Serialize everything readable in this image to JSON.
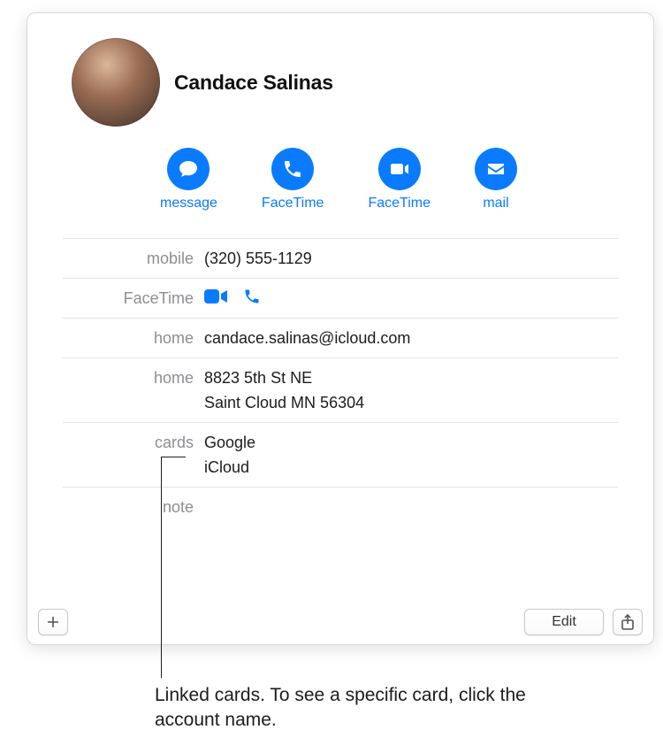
{
  "contact": {
    "name": "Candace Salinas"
  },
  "actions": {
    "message": "message",
    "facetime_video": "FaceTime",
    "facetime_audio": "FaceTime",
    "mail": "mail"
  },
  "fields": {
    "mobile_label": "mobile",
    "mobile_value": "(320) 555-1129",
    "facetime_label": "FaceTime",
    "email_label": "home",
    "email_value": "candace.salinas@icloud.com",
    "address_label": "home",
    "address_line1": "8823 5th St NE",
    "address_line2": "Saint Cloud MN 56304",
    "cards_label": "cards",
    "cards": [
      "Google",
      "iCloud"
    ],
    "note_label": "note",
    "note_value": ""
  },
  "footer": {
    "edit": "Edit"
  },
  "callout": "Linked cards. To see a specific card, click the account name."
}
